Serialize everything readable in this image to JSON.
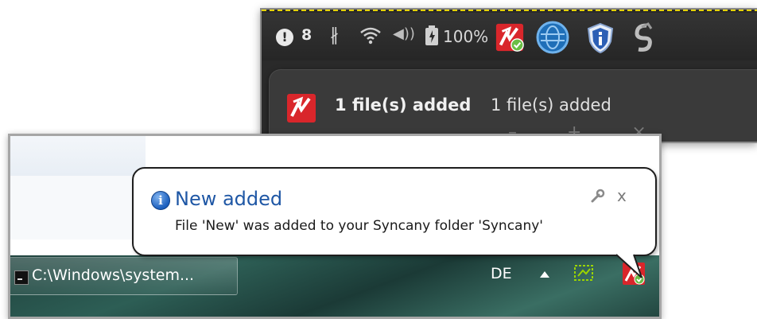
{
  "linux_panel": {
    "warning_count": "8",
    "battery": "100%",
    "icons": [
      "warning-icon",
      "bluetooth-icon",
      "wifi-icon",
      "volume-icon",
      "battery-icon",
      "syncany-icon",
      "globe-icon",
      "shield-icon",
      "scissors-icon"
    ]
  },
  "linux_notification": {
    "title": "1 file(s) added",
    "body": "1 file(s) added",
    "ghost_controls": "– + ×"
  },
  "windows_balloon": {
    "title": "New added",
    "message": "File 'New' was added to your Syncany folder 'Syncany'",
    "close": "x"
  },
  "windows_taskbar": {
    "task_label": "C:\\Windows\\system...",
    "language": "DE"
  },
  "colors": {
    "syncany_red": "#d9262b",
    "syncany_check": "#6bbd45",
    "balloon_title": "#1f57a5"
  }
}
